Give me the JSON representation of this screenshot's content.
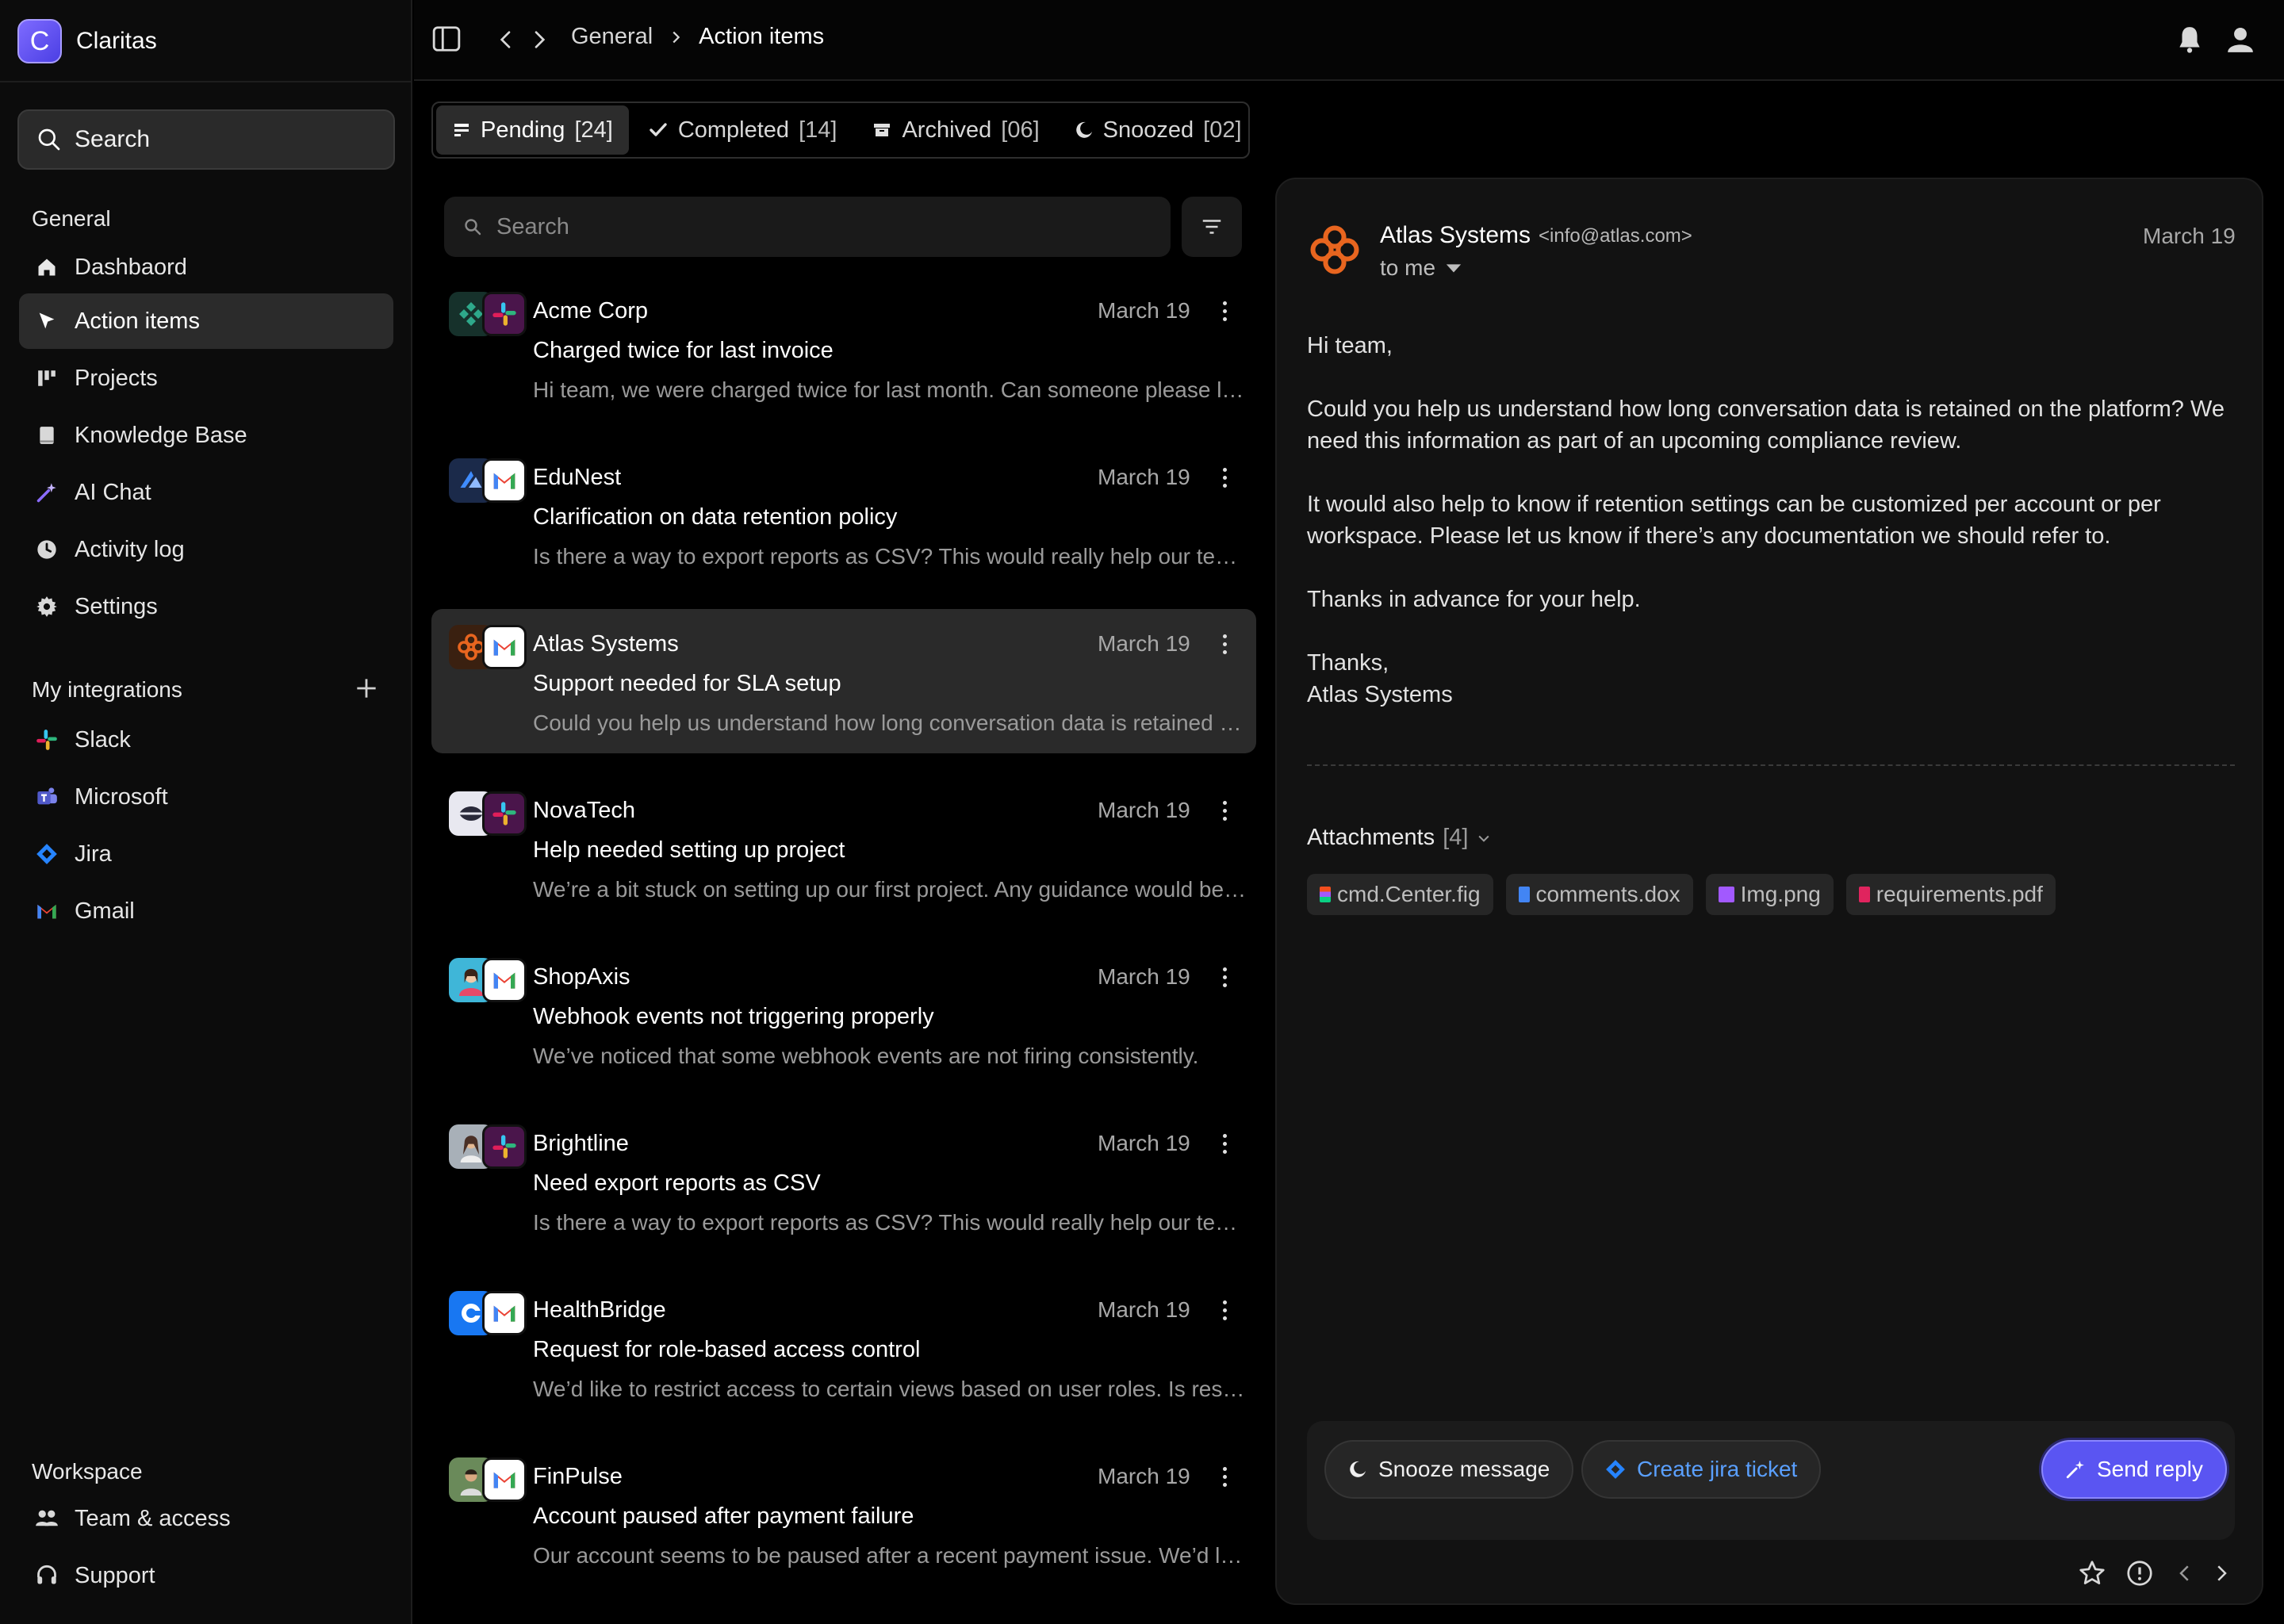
{
  "app": {
    "name": "Claritas",
    "logo_letter": "C"
  },
  "sidebar": {
    "search_label": "Search",
    "general_label": "General",
    "general_items": [
      {
        "label": "Dashbaord",
        "icon": "home-icon"
      },
      {
        "label": "Action items",
        "icon": "cursor-icon",
        "active": true
      },
      {
        "label": "Projects",
        "icon": "projects-icon"
      },
      {
        "label": "Knowledge Base",
        "icon": "book-icon"
      },
      {
        "label": "AI Chat",
        "icon": "sparkle-icon"
      },
      {
        "label": "Activity log",
        "icon": "clock-icon"
      },
      {
        "label": "Settings",
        "icon": "gear-icon"
      }
    ],
    "integrations_label": "My integrations",
    "integrations": [
      {
        "label": "Slack",
        "icon": "slack-icon"
      },
      {
        "label": "Microsoft",
        "icon": "microsoft-teams-icon"
      },
      {
        "label": "Jira",
        "icon": "jira-icon"
      },
      {
        "label": "Gmail",
        "icon": "gmail-icon"
      }
    ],
    "workspace_label": "Workspace",
    "workspace_items": [
      {
        "label": "Team & access",
        "icon": "team-icon"
      },
      {
        "label": "Support",
        "icon": "headset-icon"
      }
    ]
  },
  "topbar": {
    "breadcrumb_root": "General",
    "breadcrumb_current": "Action items"
  },
  "tabs": [
    {
      "label": "Pending",
      "count": "[24]",
      "active": true
    },
    {
      "label": "Completed",
      "count": "[14]"
    },
    {
      "label": "Archived",
      "count": "[06]"
    },
    {
      "label": "Snoozed",
      "count": "[02]"
    }
  ],
  "list": {
    "search_placeholder": "Search",
    "messages": [
      {
        "from": "Acme Corp",
        "date": "March 19",
        "subject": "Charged twice for last invoice",
        "preview": "Hi team, we were charged twice for last month. Can someone please look into this?"
      },
      {
        "from": "EduNest",
        "date": "March 19",
        "subject": "Clarification on data retention policy",
        "preview": "Is there a way to export reports as CSV? This would really help our team."
      },
      {
        "from": "Atlas Systems",
        "date": "March 19",
        "subject": "Support needed for SLA setup",
        "preview": "Could you help us understand how long conversation data is retained on the platform?",
        "selected": true
      },
      {
        "from": "NovaTech",
        "date": "March 19",
        "subject": "Help needed setting up project",
        "preview": "We’re a bit stuck on setting up our first project. Any guidance would be appreciated."
      },
      {
        "from": "ShopAxis",
        "date": "March 19",
        "subject": "Webhook events not triggering properly",
        "preview": "We’ve noticed that some webhook events are not firing consistently."
      },
      {
        "from": "Brightline",
        "date": "March 19",
        "subject": "Need export reports as CSV",
        "preview": "Is there a way to export reports as CSV? This would really help our team."
      },
      {
        "from": "HealthBridge",
        "date": "March 19",
        "subject": "Request for role-based access control",
        "preview": "We’d like to restrict access to certain views based on user roles. Is respecting this possible?"
      },
      {
        "from": "FinPulse",
        "date": "March 19",
        "subject": "Account paused after payment failure",
        "preview": "Our account seems to be paused after a recent payment issue. We’d like to resolve it."
      }
    ]
  },
  "detail": {
    "sender": "Atlas Systems",
    "email": "<info@atlas.com>",
    "to": "to me",
    "date": "March 19",
    "body": [
      "Hi team,",
      "Could you help us understand how long conversation data is retained on the platform? We need this information as part of an upcoming compliance review.",
      "It would also help to know if retention settings can be customized per account or per workspace. Please let us know if there’s any documentation we should refer to.",
      "Thanks in advance for your help.",
      "Thanks,\nAtlas Systems"
    ],
    "attachments_label": "Attachments",
    "attachments_count": "[4]",
    "attachments": [
      {
        "name": "cmd.Center.fig",
        "color": "#f24e1e"
      },
      {
        "name": "comments.dox",
        "color": "#4285f4"
      },
      {
        "name": "Img.png",
        "color": "#a259ff"
      },
      {
        "name": "requirements.pdf",
        "color": "#e0245e"
      }
    ],
    "snooze_label": "Snooze message",
    "jira_label": "Create jira ticket",
    "send_label": "Send reply"
  },
  "colors": {
    "accent": "#5a55f2",
    "jira_blue": "#5aa0ff",
    "atlas_orange": "#e8651f"
  }
}
